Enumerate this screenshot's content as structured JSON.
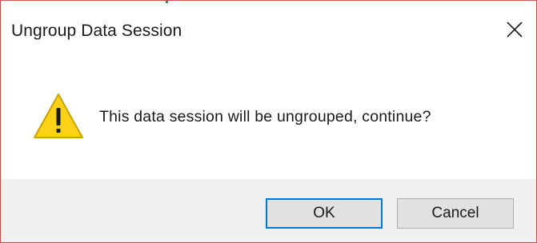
{
  "dialog": {
    "title": "Ungroup Data Session",
    "message": "This data session will be ungrouped, continue?",
    "icon": "warning-icon",
    "buttons": {
      "ok_label": "OK",
      "cancel_label": "Cancel"
    }
  },
  "colors": {
    "border": "#c0504d",
    "footer_bg": "#f0f0f0",
    "default_button_border": "#0078d7",
    "warning_fill": "#fcd116"
  }
}
